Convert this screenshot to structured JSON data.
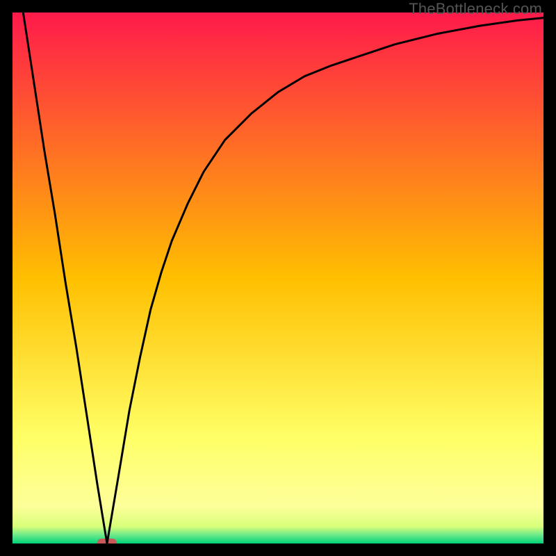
{
  "watermark": "TheBottleneck.com",
  "chart_data": {
    "type": "line",
    "title": "",
    "xlabel": "",
    "ylabel": "",
    "xlim": [
      0,
      100
    ],
    "ylim": [
      0,
      100
    ],
    "grid": false,
    "legend": false,
    "background_gradient": {
      "stops": [
        {
          "pos": 0.0,
          "color": "#ff1a4b"
        },
        {
          "pos": 0.5,
          "color": "#ffbf00"
        },
        {
          "pos": 0.8,
          "color": "#ffff66"
        },
        {
          "pos": 0.93,
          "color": "#fdff9a"
        },
        {
          "pos": 0.968,
          "color": "#d8ff7a"
        },
        {
          "pos": 0.985,
          "color": "#66e88a"
        },
        {
          "pos": 1.0,
          "color": "#00d47a"
        }
      ]
    },
    "minimum_marker": {
      "x": 17.8,
      "y": 0,
      "color": "#c95a5a"
    },
    "series": [
      {
        "name": "bottleneck-curve",
        "color": "#000000",
        "x": [
          2,
          4,
          6,
          8,
          10,
          12,
          14,
          16,
          17.8,
          20,
          22,
          24,
          26,
          28,
          30,
          33,
          36,
          40,
          45,
          50,
          55,
          60,
          66,
          72,
          80,
          88,
          95,
          100
        ],
        "y": [
          100,
          87,
          74,
          62,
          49,
          37,
          24,
          11,
          0,
          13,
          25,
          35,
          44,
          51,
          57,
          64,
          70,
          76,
          81,
          85,
          88,
          90,
          92,
          94,
          96,
          97.5,
          98.5,
          99
        ]
      }
    ]
  }
}
